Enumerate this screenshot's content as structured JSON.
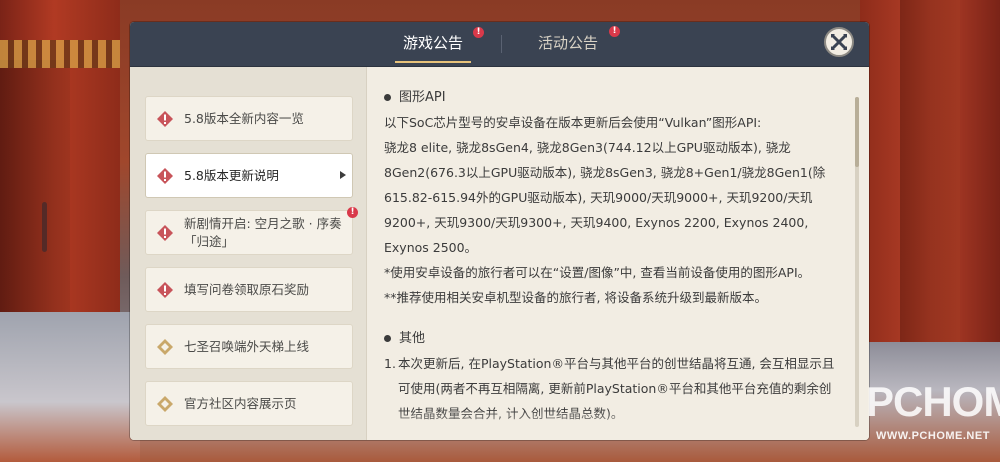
{
  "tabs": [
    {
      "label": "游戏公告",
      "active": true,
      "badge": "!"
    },
    {
      "label": "活动公告",
      "active": false,
      "badge": "!"
    }
  ],
  "close_icon": "close-x-icon",
  "list_items": [
    {
      "label": "5.8版本全新内容一览",
      "icon": "warning-diamond-icon"
    },
    {
      "label": "5.8版本更新说明",
      "icon": "warning-diamond-icon",
      "selected": true
    },
    {
      "label": "新剧情开启: 空月之歌 · 序奏「归途」",
      "icon": "warning-diamond-icon",
      "badge": "!"
    },
    {
      "label": "填写问卷领取原石奖励",
      "icon": "warning-diamond-icon"
    },
    {
      "label": "七圣召唤端外天梯上线",
      "icon": "card-diamond-icon"
    },
    {
      "label": "官方社区内容展示页",
      "icon": "card-diamond-icon"
    }
  ],
  "content": {
    "section1_title": "图形API",
    "p1": "以下SoC芯片型号的安卓设备在版本更新后会使用“Vulkan”图形API:",
    "p2": "骁龙8 elite, 骁龙8sGen4, 骁龙8Gen3(744.12以上GPU驱动版本), 骁龙8Gen2(676.3以上GPU驱动版本), 骁龙8sGen3, 骁龙8+Gen1/骁龙8Gen1(除615.82-615.94外的GPU驱动版本), 天玑9000/天玑9000+, 天玑9200/天玑9200+, 天玑9300/天玑9300+, 天玑9400, Exynos 2200, Exynos 2400, Exynos 2500。",
    "p3": "*使用安卓设备的旅行者可以在“设置/图像”中, 查看当前设备使用的图形API。",
    "p4": "**推荐使用相关安卓机型设备的旅行者, 将设备系统升级到最新版本。",
    "section2_title": "其他",
    "ol1_num": "1.",
    "ol1": "本次更新后, 在PlayStation®平台与其他平台的创世结晶将互通, 会互相显示且可使用(两者不再互相隔离, 更新前PlayStation®平台和其他平台充值的剩余创世结晶数量会合并, 计入创世结晶总数)。"
  },
  "watermark": {
    "text": "PCHOME",
    "url": "WWW.PCHOME.NET"
  },
  "colors": {
    "header": "#3a4352",
    "accent_gold": "#e7c27a",
    "badge_red": "#d9394a",
    "panel": "#f2ede3"
  }
}
